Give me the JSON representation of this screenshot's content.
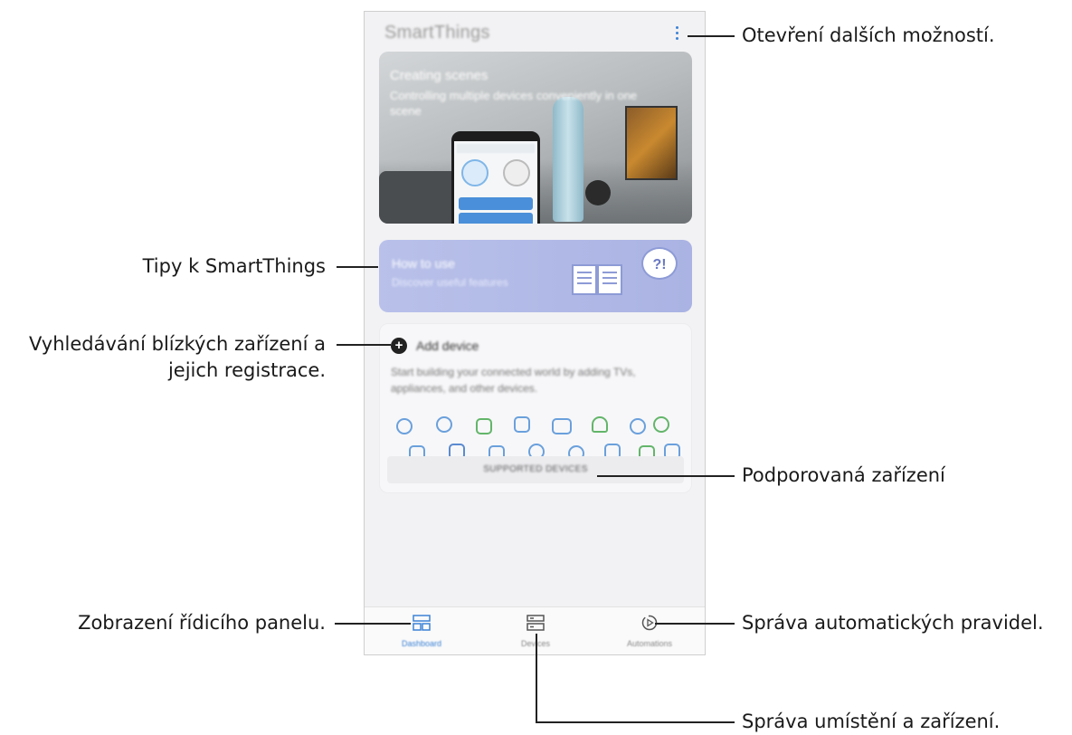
{
  "app": {
    "title": "SmartThings",
    "accent_color": "#3c82d6"
  },
  "hero_card": {
    "heading": "Creating scenes",
    "subtitle": "Controlling multiple devices conveniently in one scene"
  },
  "tips_card": {
    "title": "How to use",
    "subtitle": "Discover useful features"
  },
  "add_device_card": {
    "title": "Add device",
    "description": "Start building your connected world by adding TVs, appliances, and other devices.",
    "supported_button": "SUPPORTED DEVICES"
  },
  "bottom_nav": [
    {
      "label": "Dashboard",
      "icon": "dashboard-icon",
      "active": true
    },
    {
      "label": "Devices",
      "icon": "devices-icon",
      "active": false
    },
    {
      "label": "Automations",
      "icon": "automations-icon",
      "active": false
    }
  ],
  "callouts": {
    "more_options": "Otevření dalších možností.",
    "tips": "Tipy k SmartThings",
    "add_device_line1": "Vyhledávání blízkých zařízení a",
    "add_device_line2": "jejich registrace.",
    "supported_devices": "Podporovaná zařízení",
    "dashboard": "Zobrazení řídicího panelu.",
    "automations": "Správa automatických pravidel.",
    "devices": "Správa umístění a zařízení."
  }
}
